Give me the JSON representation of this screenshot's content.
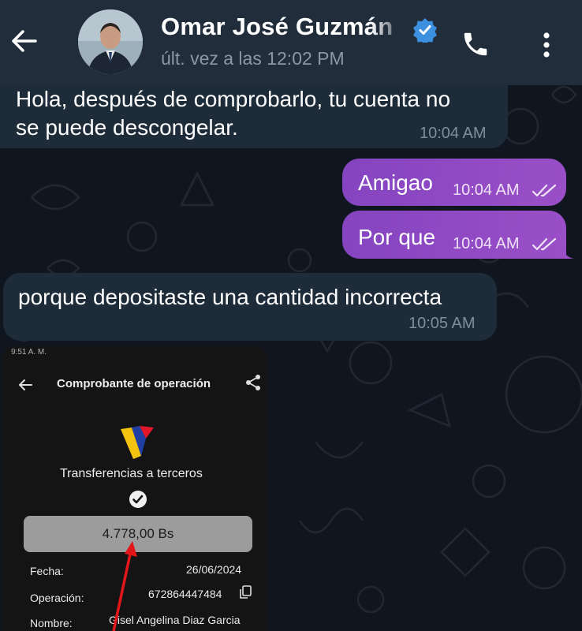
{
  "header": {
    "contact_name": "Omar José Guzmán",
    "status": "últ. vez a las 12:02 PM",
    "icons": [
      "back-arrow-icon",
      "avatar",
      "verified-badge-icon",
      "phone-icon",
      "more-vertical-icon"
    ]
  },
  "messages": [
    {
      "direction": "incoming",
      "lines": [
        "Hola, después de comprobarlo, tu cuenta no",
        "se puede descongelar."
      ],
      "time": "10:04 AM"
    },
    {
      "direction": "outgoing",
      "text": "Amigao",
      "time": "10:04 AM",
      "read": true
    },
    {
      "direction": "outgoing",
      "text": "Por que",
      "time": "10:04 AM",
      "read": true
    },
    {
      "direction": "incoming",
      "text": "porque depositaste una cantidad incorrecta",
      "time": "10:05 AM"
    }
  ],
  "receipt": {
    "status_bar": "9:51 A. M.",
    "title": "Comprobante de operación",
    "subtitle": "Transferencias a terceros",
    "amount": "4.778,00 Bs",
    "rows": [
      {
        "label": "Fecha:",
        "value": "26/06/2024"
      },
      {
        "label": "Operación:",
        "value": "672864447484"
      },
      {
        "label": "Nombre:",
        "value": "Gisel Angelina Diaz Garcia"
      }
    ]
  },
  "colors": {
    "header_bg": "#212d3b",
    "chat_bg": "#101620",
    "incoming_bubble": "#1e2c3a",
    "outgoing_bubble": "#8c46c0",
    "verified": "#3d8fe0",
    "annotation_arrow": "#e3161a"
  }
}
